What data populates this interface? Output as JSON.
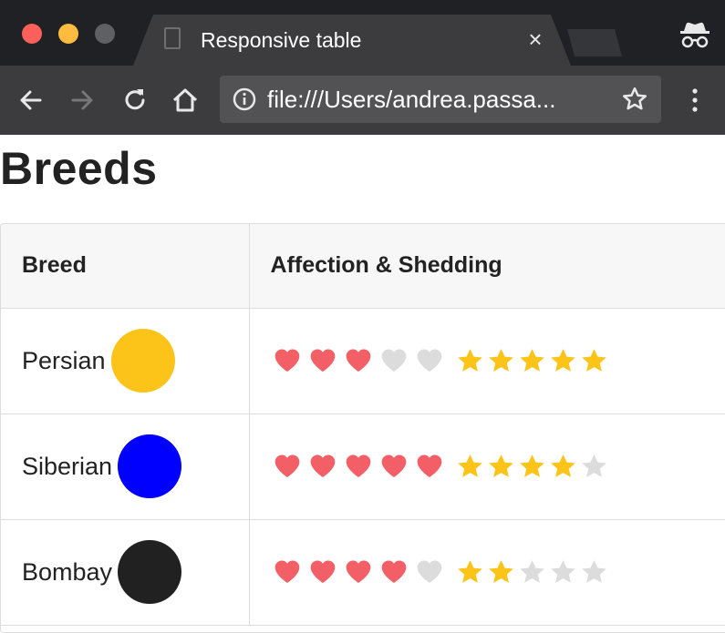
{
  "browser": {
    "tab_title": "Responsive table",
    "tab_close_glyph": "×",
    "url": "file:///Users/andrea.passa...",
    "icons": {
      "back": "back-arrow-icon",
      "forward": "forward-arrow-icon",
      "reload": "reload-icon",
      "home": "home-icon",
      "info": "info-icon",
      "bookmark": "star-icon",
      "menu": "kebab-menu-icon",
      "incognito": "incognito-icon"
    }
  },
  "page": {
    "title": "Breeds"
  },
  "table": {
    "headers": [
      "Breed",
      "Affection & Shedding"
    ],
    "rows": [
      {
        "breed": "Persian",
        "color": "#fcc419",
        "affection": 3,
        "shedding": 5
      },
      {
        "breed": "Siberian",
        "color": "#0000ff",
        "affection": 5,
        "shedding": 4
      },
      {
        "breed": "Bombay",
        "color": "#212121",
        "affection": 4,
        "shedding": 2
      }
    ],
    "max_rating": 5
  },
  "colors": {
    "heart_on": "#f25f66",
    "heart_off": "#dcdcdc",
    "star_on": "#fcc419",
    "star_off": "#dcdcdc"
  }
}
